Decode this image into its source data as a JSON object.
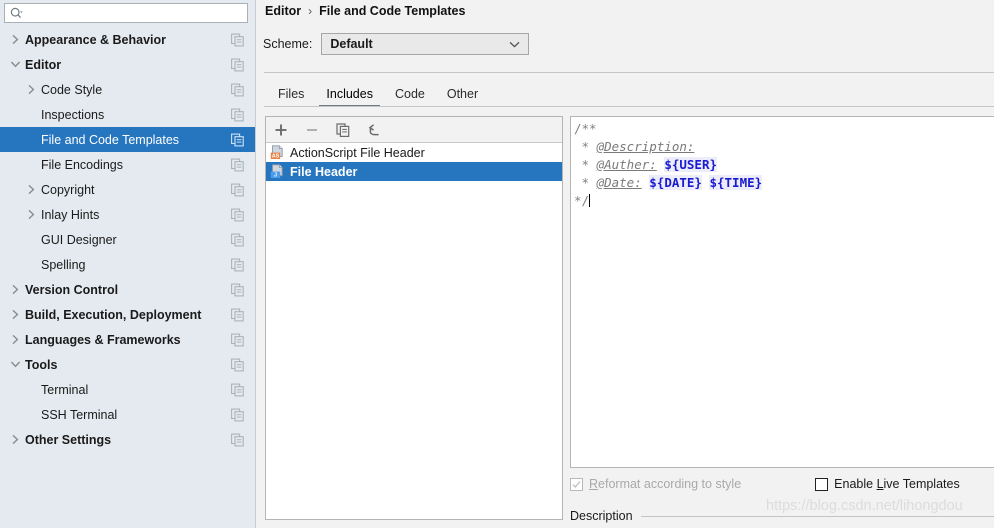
{
  "sidebar": {
    "search": {
      "placeholder": "",
      "value": "",
      "icon": "search-icon"
    },
    "items": [
      {
        "label": "Appearance & Behavior",
        "bold": true,
        "indent": 0,
        "chevron": "right",
        "selected": false
      },
      {
        "label": "Editor",
        "bold": true,
        "indent": 0,
        "chevron": "down",
        "selected": false
      },
      {
        "label": "Code Style",
        "bold": false,
        "indent": 1,
        "chevron": "right",
        "selected": false
      },
      {
        "label": "Inspections",
        "bold": false,
        "indent": 1,
        "chevron": "none",
        "selected": false
      },
      {
        "label": "File and Code Templates",
        "bold": false,
        "indent": 1,
        "chevron": "none",
        "selected": true
      },
      {
        "label": "File Encodings",
        "bold": false,
        "indent": 1,
        "chevron": "none",
        "selected": false
      },
      {
        "label": "Copyright",
        "bold": false,
        "indent": 1,
        "chevron": "right",
        "selected": false
      },
      {
        "label": "Inlay Hints",
        "bold": false,
        "indent": 1,
        "chevron": "right",
        "selected": false
      },
      {
        "label": "GUI Designer",
        "bold": false,
        "indent": 1,
        "chevron": "none",
        "selected": false
      },
      {
        "label": "Spelling",
        "bold": false,
        "indent": 1,
        "chevron": "none",
        "selected": false
      },
      {
        "label": "Version Control",
        "bold": true,
        "indent": 0,
        "chevron": "right",
        "selected": false
      },
      {
        "label": "Build, Execution, Deployment",
        "bold": true,
        "indent": 0,
        "chevron": "right",
        "selected": false
      },
      {
        "label": "Languages & Frameworks",
        "bold": true,
        "indent": 0,
        "chevron": "right",
        "selected": false
      },
      {
        "label": "Tools",
        "bold": true,
        "indent": 0,
        "chevron": "down",
        "selected": false
      },
      {
        "label": "Terminal",
        "bold": false,
        "indent": 1,
        "chevron": "none",
        "selected": false
      },
      {
        "label": "SSH Terminal",
        "bold": false,
        "indent": 1,
        "chevron": "none",
        "selected": false
      },
      {
        "label": "Other Settings",
        "bold": true,
        "indent": 0,
        "chevron": "right",
        "selected": false
      }
    ]
  },
  "header": {
    "breadcrumb_parent": "Editor",
    "breadcrumb_separator": "›",
    "breadcrumb_current": "File and Code Templates",
    "scheme_label": "Scheme:",
    "scheme_value": "Default",
    "scheme_arrow_icon": "chevron-down-icon"
  },
  "tabs": [
    {
      "label": "Files",
      "active": false
    },
    {
      "label": "Includes",
      "active": true
    },
    {
      "label": "Code",
      "active": false
    },
    {
      "label": "Other",
      "active": false
    }
  ],
  "list_toolbar": [
    {
      "icon": "plus-icon",
      "name": "add-template-button"
    },
    {
      "icon": "minus-icon",
      "name": "remove-template-button"
    },
    {
      "icon": "copy-icon",
      "name": "copy-template-button"
    },
    {
      "icon": "revert-icon",
      "name": "reset-template-button"
    }
  ],
  "template_list": [
    {
      "label": "ActionScript File Header",
      "badge": "AS",
      "badge_color": "#e8834a",
      "selected": false
    },
    {
      "label": "File Header",
      "badge": "J",
      "badge_color": "#4a9de8",
      "selected": true
    }
  ],
  "editor": {
    "lines": [
      {
        "parts": [
          {
            "text": "/**",
            "style": "comment"
          }
        ]
      },
      {
        "parts": [
          {
            "text": " * ",
            "style": "comment"
          },
          {
            "text": "@Description:",
            "style": "tag"
          }
        ]
      },
      {
        "parts": [
          {
            "text": " * ",
            "style": "comment"
          },
          {
            "text": "@Auther:",
            "style": "tag"
          },
          {
            "text": " ",
            "style": "comment"
          },
          {
            "text": "${USER}",
            "style": "var"
          }
        ]
      },
      {
        "parts": [
          {
            "text": " * ",
            "style": "comment"
          },
          {
            "text": "@Date:",
            "style": "tag"
          },
          {
            "text": " ",
            "style": "comment"
          },
          {
            "text": "${DATE}",
            "style": "var"
          },
          {
            "text": " ",
            "style": "comment"
          },
          {
            "text": "${TIME}",
            "style": "var"
          }
        ]
      },
      {
        "parts": [
          {
            "text": "*/",
            "style": "comment"
          },
          {
            "text": "",
            "style": "caret"
          }
        ]
      }
    ]
  },
  "options": {
    "reformat": {
      "label": "Reformat according to style",
      "mnemonic": "R",
      "checked": true,
      "disabled": true
    },
    "live_templates": {
      "label": "Enable Live Templates",
      "mnemonic": "L",
      "checked": false,
      "disabled": false
    }
  },
  "description": {
    "label": "Description"
  },
  "watermark": {
    "text": "https://blog.csdn.net/lihongdou"
  },
  "colors": {
    "accent_selection": "#2675bf",
    "sidebar_bg": "#e5eaf0",
    "pane_bg": "#f2f2f2",
    "variable_blue": "#1a1ad0",
    "comment_gray": "#808080"
  }
}
